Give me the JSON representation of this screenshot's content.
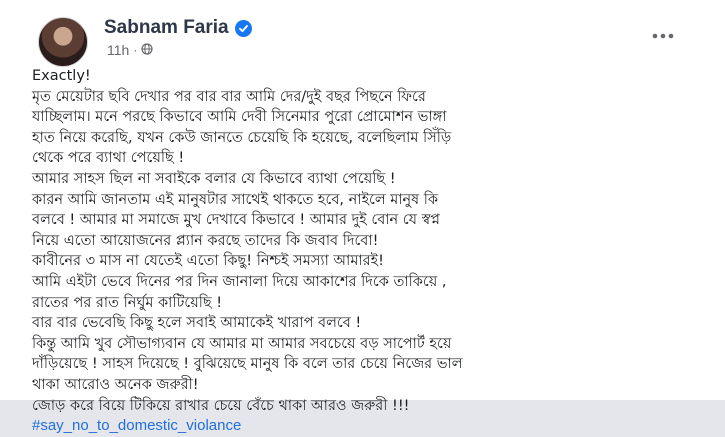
{
  "post": {
    "author": "Sabnam Faria",
    "time": "11h",
    "separator": "·",
    "lines": [
      "Exactly!",
      "মৃত মেয়েটার ছবি দেখার পর বার বার আমি দের/দুই বছর পিছনে ফিরে",
      "যাচ্ছিলাম। মনে পরছে কিভাবে আমি দেবী সিনেমার পুরো প্রোমোশন ভাঙ্গা",
      "হাত নিয়ে করেছি, যখন কেউ জানতে চেয়েছি কি হয়েছে, বলেছিলাম সিঁড়ি",
      "থেকে পরে ব্যাথা পেয়েছি !",
      "আমার সাহস ছিল না সবাইকে বলার যে কিভাবে ব্যাথা পেয়েছি !",
      "কারন আমি জানতাম এই মানুষটার সাথেই থাকতে হবে, নাইলে মানুষ কি",
      "বলবে ! আমার মা সমাজে মুখ দেখাবে কিভাবে ! আমার দুই বোন যে স্বপ্ন",
      "নিয়ে এতো আয়োজনের প্ল্যান করছে তাদের কি জবাব দিবো!",
      "কাবীনের ৩ মাস না যেতেই এতো কিছু! নিশ্চই সমস্যা আমারই!",
      "আমি এইটা ভেবে দিনের পর দিন জানালা দিয়ে আকাশের দিকে তাকিয়ে ,",
      "রাতের পর রাত নির্ঘুম কাটিয়েছি !",
      "বার বার ভেবেছি কিছু হলে সবাই আমাকেই খারাপ বলবে !",
      "কিন্তু আমি খুব সৌভাগ্যবান যে আমার মা আমার সবচেয়ে বড় সাপোর্ট হয়ে",
      "দাঁড়িয়েছে ! সাহস দিয়েছে ! বুঝিয়েছে মানুষ কি বলে তার চেয়ে নিজের ভাল",
      "থাকা আরোও অনেক জরুরী!",
      "জোড় করে বিয়ে টিকিয়ে রাখার চেয়ে বেঁচে থাকা আরও জরুরী !!!"
    ],
    "hashtag": "#say_no_to_domestic_violance"
  },
  "icons": {
    "audience": "globe-icon",
    "verified": "verified-badge-icon",
    "menu": "more-options-icon"
  },
  "colors": {
    "background": "#ffffff",
    "name": "#2d3748",
    "meta": "#65676b",
    "hashtag": "#216fdb",
    "verified": "#1877f2"
  }
}
